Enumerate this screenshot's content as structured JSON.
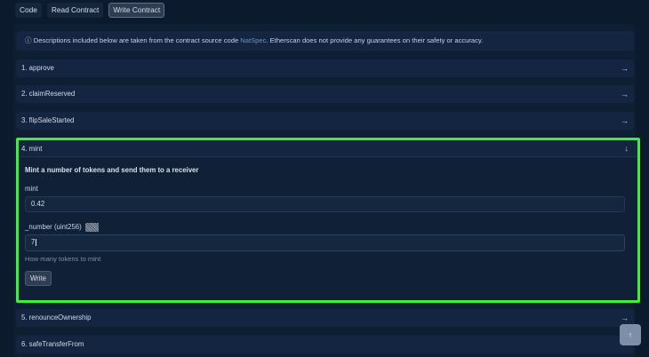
{
  "tabs": [
    {
      "label": "Code"
    },
    {
      "label": "Read Contract"
    },
    {
      "label": "Write Contract"
    }
  ],
  "notice": {
    "icon": "info-icon",
    "text_before": "Descriptions included below are taken from the contract source code ",
    "link": "NatSpec",
    "text_after": ". Etherscan does not provide any guarantees on their safety or accuracy."
  },
  "functions": [
    {
      "label": "1. approve"
    },
    {
      "label": "2. claimReserved"
    },
    {
      "label": "3. flipSaleStarted"
    },
    {
      "label": "4. mint"
    },
    {
      "label": "5. renounceOwnership"
    },
    {
      "label": "6. safeTransferFrom"
    }
  ],
  "mint": {
    "description": "Mint a number of tokens and send them to a receiver",
    "payable_label": "mint",
    "payable_value": "0.42",
    "param_label": "_number (uint256)",
    "param_value": "7",
    "hint": "How many tokens to mint",
    "write_label": "Write"
  },
  "icons": {
    "row_arrow": "→",
    "expanded_arrow": "↓",
    "scroll_top": "↑"
  },
  "colors": {
    "highlight": "#3df03a",
    "background": "#0b1a2d",
    "link": "#6f95c9"
  }
}
